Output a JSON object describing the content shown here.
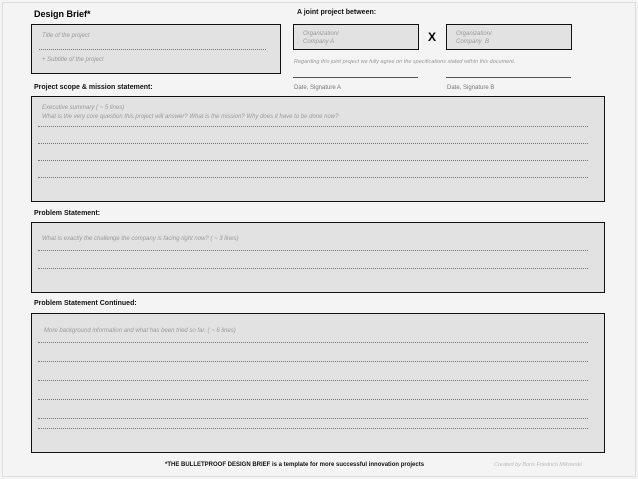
{
  "title": "Design Brief*",
  "title_box": {
    "title_hint": "Title of the project",
    "subtitle_hint": "+ Subtitle of the project"
  },
  "joint": {
    "label": "A joint project between:",
    "org_a": "Organization/\nCompany A",
    "org_b": "Organization/\nCompany  B",
    "x": "X",
    "agreement": "Regarding this joint project we fully agree on the specifications stated within this document.",
    "sig_a": "Date, Signature A",
    "sig_b": "Date, Signature B"
  },
  "scope": {
    "label": "Project scope & mission statement:",
    "hint1": "Executive summary ( ~ 5 lines)",
    "hint2": "What is the very core question this project will answer? What is the mission? Why does it have to be done now?"
  },
  "problem": {
    "label": "Problem Statement:",
    "hint": "What is exactly the challenge the company is facing right now? ( ~ 3 lines)"
  },
  "problem_cont": {
    "label": "Problem Statement Continued:",
    "hint": "More background information and what has been tried so far. ( ~ 6 lines)"
  },
  "footer": {
    "tagline": "*THE BULLETPROOF DESIGN BRIEF is a template for more successful innovation projects",
    "credit": "Created by Boris Friedrich Mikowski"
  }
}
